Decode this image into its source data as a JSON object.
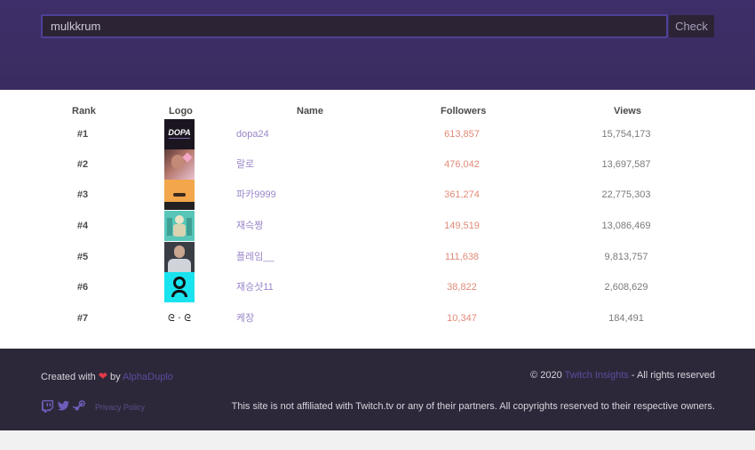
{
  "search": {
    "value": "mulkkrum"
  },
  "check_label": "Check",
  "table": {
    "headers": {
      "rank": "Rank",
      "logo": "Logo",
      "name": "Name",
      "followers": "Followers",
      "views": "Views"
    },
    "rows": [
      {
        "rank": "#1",
        "name": "dopa24",
        "followers": "613,857",
        "views": "15,754,173",
        "logo_text": "DOPA"
      },
      {
        "rank": "#2",
        "name": "랄로",
        "followers": "476,042",
        "views": "13,697,587",
        "logo_text": ""
      },
      {
        "rank": "#3",
        "name": "파카9999",
        "followers": "361,274",
        "views": "22,775,303",
        "logo_text": ""
      },
      {
        "rank": "#4",
        "name": "재슥짱",
        "followers": "149,519",
        "views": "13,086,469",
        "logo_text": ""
      },
      {
        "rank": "#5",
        "name": "플레임__",
        "followers": "111,638",
        "views": "9,813,757",
        "logo_text": ""
      },
      {
        "rank": "#6",
        "name": "재승샷11",
        "followers": "38,822",
        "views": "2,608,629",
        "logo_text": ""
      },
      {
        "rank": "#7",
        "name": "케장",
        "followers": "10,347",
        "views": "184,491",
        "logo_text": "ᘓ · ᘓ"
      }
    ]
  },
  "footer": {
    "created_prefix": "Created with",
    "created_by": "by",
    "author": "AlphaDuplo",
    "copyright_prefix": "© 2020",
    "brand": "Twitch Insights",
    "rights": "- All rights reserved",
    "disclaimer": "This site is not affiliated with Twitch.tv or any of their partners. All copyrights reserved to their respective owners.",
    "privacy": "Privacy Policy",
    "social_icons": [
      "twitch-icon",
      "twitter-icon",
      "steam-icon"
    ]
  },
  "colors": {
    "header_bg": "#3f2e69",
    "footer_bg": "#2d2839",
    "name_link": "#9a86c8",
    "followers": "#e08a78",
    "heart": "#e23a4a"
  }
}
